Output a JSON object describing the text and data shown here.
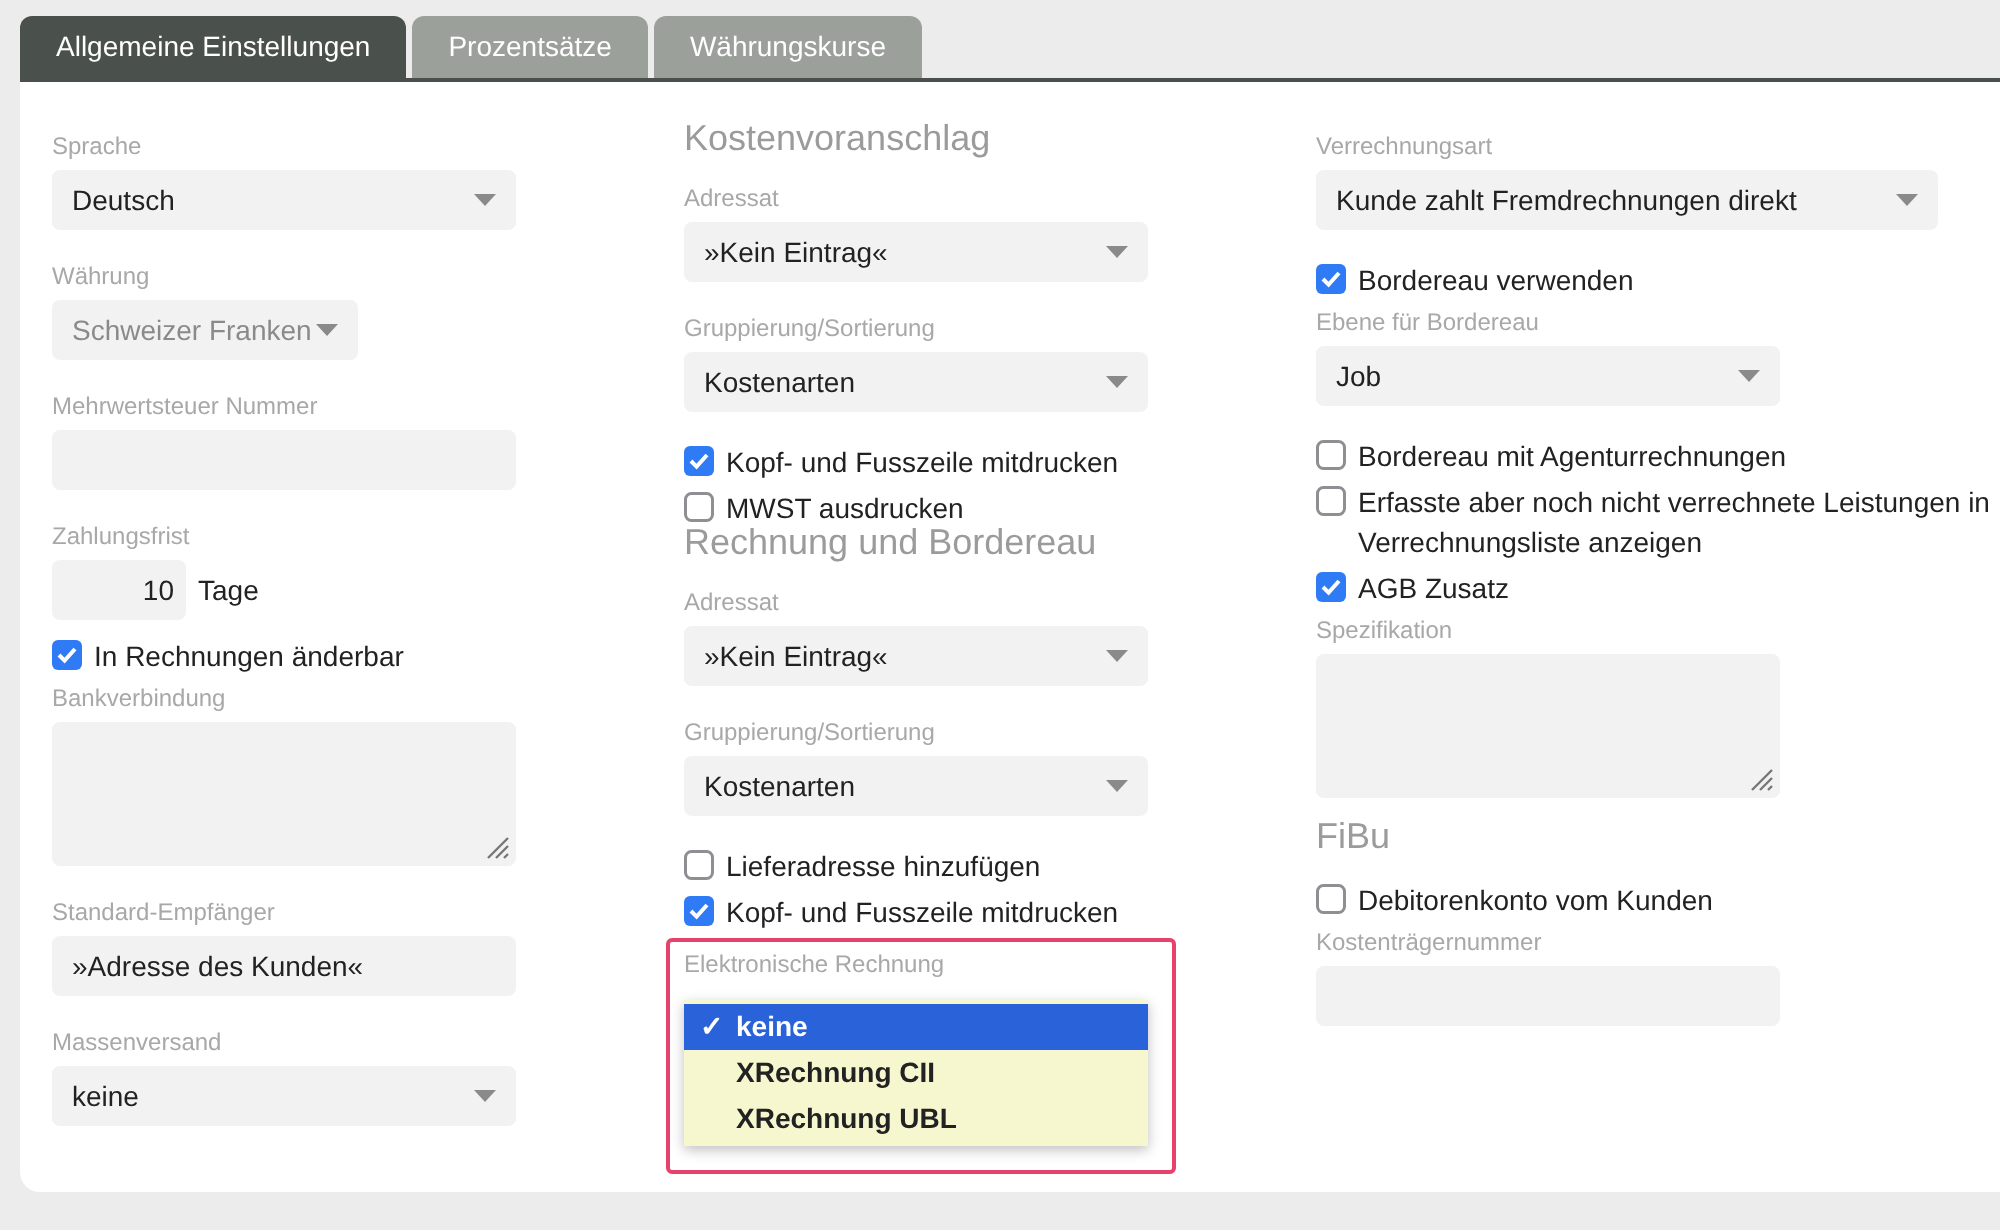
{
  "tabs": [
    {
      "label": "Allgemeine Einstellungen",
      "selected": true
    },
    {
      "label": "Prozentsätze",
      "selected": false
    },
    {
      "label": "Währungskurse",
      "selected": false
    }
  ],
  "columns": [
    [
      {
        "kind": "select",
        "label": "Sprache",
        "value": "Deutsch"
      },
      {
        "kind": "select",
        "label": "Währung",
        "value": "Schweizer Franken",
        "disabled": true
      },
      {
        "kind": "input",
        "label": "Mehrwertsteuer Nummer"
      },
      {
        "kind": "number",
        "label": "Zahlungsfrist",
        "value": "10",
        "unit": "Tage"
      },
      {
        "kind": "checkbox",
        "label": "In Rechnungen änderbar",
        "checked": true
      },
      {
        "kind": "textarea",
        "label": "Bankverbindung"
      },
      {
        "kind": "input",
        "label": "Standard-Empfänger",
        "value": "»Adresse des Kunden«"
      },
      {
        "kind": "select",
        "label": "Massenversand",
        "value": "keine"
      }
    ],
    [
      {
        "kind": "heading",
        "label": "Kostenvoranschlag"
      },
      {
        "kind": "select",
        "label": "Adressat",
        "value": "»Kein Eintrag«"
      },
      {
        "kind": "select",
        "label": "Gruppierung/Sortierung",
        "value": "Kostenarten"
      },
      {
        "kind": "checkbox",
        "label": "Kopf- und Fusszeile mitdrucken",
        "checked": true
      },
      {
        "kind": "checkbox",
        "label": "MWST ausdrucken",
        "checked": false
      },
      {
        "kind": "heading",
        "label": "Rechnung und Bordereau"
      },
      {
        "kind": "select",
        "label": "Adressat",
        "value": "»Kein Eintrag«"
      },
      {
        "kind": "select",
        "label": "Gruppierung/Sortierung",
        "value": "Kostenarten"
      },
      {
        "kind": "checkbox",
        "label": "Lieferadresse hinzufügen",
        "checked": false
      },
      {
        "kind": "checkbox",
        "label": "Kopf- und Fusszeile mitdrucken",
        "checked": true
      },
      {
        "kind": "popup",
        "label": "Elektronische Rechnung",
        "highlighted": true,
        "check_mark": "✓",
        "options": [
          {
            "label": "keine",
            "selected": true
          },
          {
            "label": "XRechnung CII",
            "selected": false
          },
          {
            "label": "XRechnung UBL",
            "selected": false
          }
        ]
      }
    ],
    [
      {
        "kind": "select",
        "label": "Verrechnungsart",
        "value": "Kunde zahlt Fremdrechnungen direkt",
        "wide": true
      },
      {
        "kind": "checkbox",
        "label": "Bordereau verwenden",
        "checked": true
      },
      {
        "kind": "select",
        "label": "Ebene für Bordereau",
        "value": "Job"
      },
      {
        "kind": "checkbox",
        "label": "Bordereau mit Agenturrechnungen",
        "checked": false
      },
      {
        "kind": "checkbox",
        "label": "Erfasste aber noch nicht verrechnete Leistungen in Verrechnungsliste anzeigen",
        "checked": false
      },
      {
        "kind": "checkbox",
        "label": "AGB Zusatz",
        "checked": true
      },
      {
        "kind": "textarea",
        "label": "Spezifikation"
      },
      {
        "kind": "heading",
        "label": "FiBu"
      },
      {
        "kind": "checkbox",
        "label": "Debitorenkonto vom Kunden",
        "checked": false
      },
      {
        "kind": "input",
        "label": "Kostenträgernummer"
      }
    ]
  ]
}
